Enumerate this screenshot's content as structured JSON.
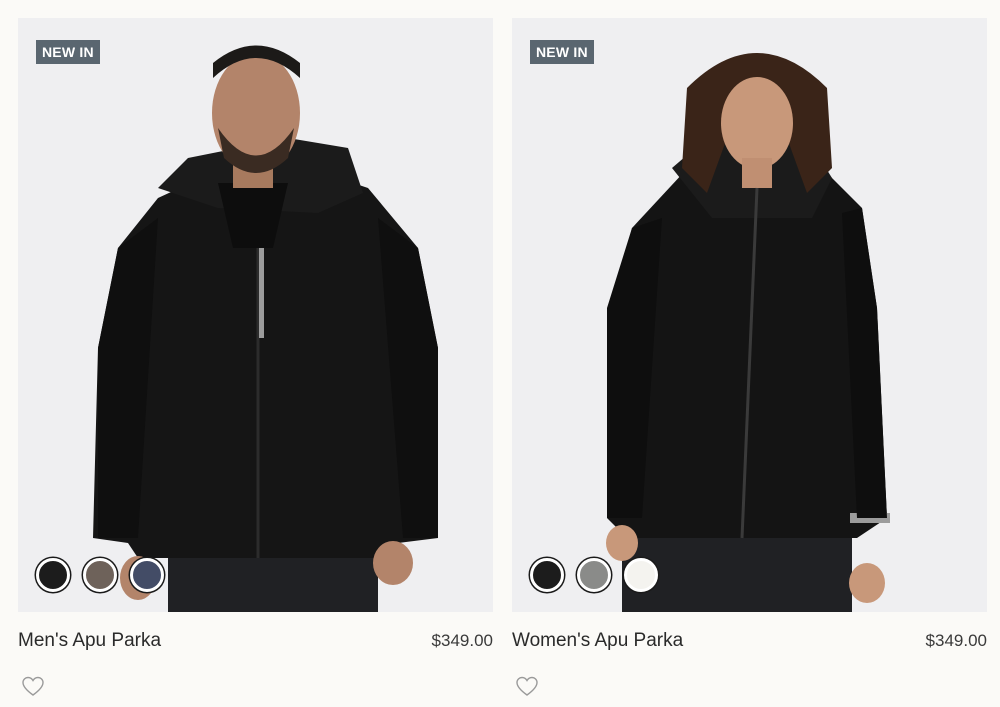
{
  "products": [
    {
      "badge": "NEW IN",
      "name": "Men's Apu Parka",
      "price": "$349.00",
      "swatches": [
        {
          "color": "#1c1c1c"
        },
        {
          "color": "#6e625a"
        },
        {
          "color": "#434c66"
        }
      ],
      "fav_icon": "heart-icon"
    },
    {
      "badge": "NEW IN",
      "name": "Women's Apu Parka",
      "price": "$349.00",
      "swatches": [
        {
          "color": "#1c1c1c"
        },
        {
          "color": "#8a8b89"
        },
        {
          "color": "#f4f3ef"
        }
      ],
      "fav_icon": "heart-icon"
    }
  ]
}
